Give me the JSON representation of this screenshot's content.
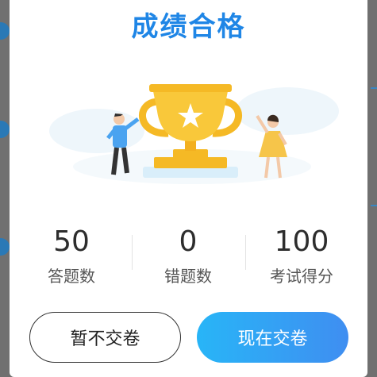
{
  "dialog": {
    "title": "成绩合格"
  },
  "stats": [
    {
      "value": "50",
      "label": "答题数"
    },
    {
      "value": "0",
      "label": "错题数"
    },
    {
      "value": "100",
      "label": "考试得分"
    }
  ],
  "buttons": {
    "later_label": "暂不交卷",
    "submit_label": "现在交卷"
  },
  "colors": {
    "accent": "#1f86e6",
    "submit_gradient_start": "#28b5f7",
    "submit_gradient_end": "#3f8ef1",
    "trophy": "#f7c531"
  }
}
